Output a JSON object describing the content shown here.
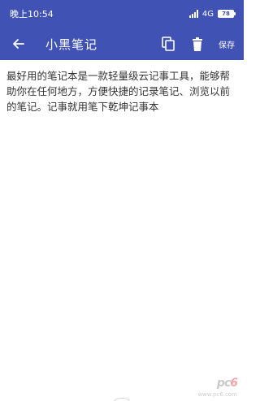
{
  "status_bar": {
    "time": "晚上10:54",
    "network": "4G",
    "battery": "78"
  },
  "toolbar": {
    "title": "小黑笔记",
    "save_label": "保存",
    "background": "#4053b5"
  },
  "note": {
    "body": "最好用的笔记本是一款轻量级云记事工具，能够帮助你在任何地方，方便快捷的记录笔记、浏览以前的笔记。记事就用笔下乾坤记事本"
  },
  "watermark": {
    "logo": "pc6",
    "subtitle": "www.pc6.com"
  },
  "icons": {
    "back": "arrow-back-icon",
    "copy": "copy-icon",
    "delete": "trash-icon"
  }
}
